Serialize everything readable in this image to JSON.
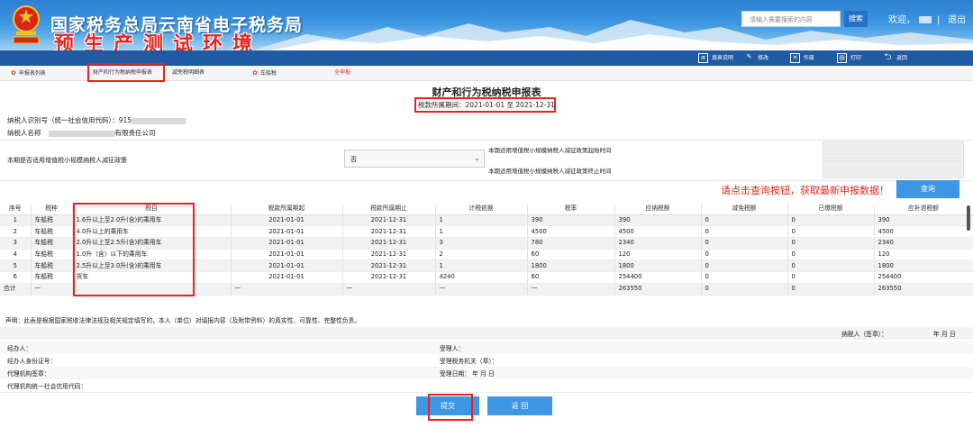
{
  "header": {
    "site_title": "国家税务总局云南省电子税务局",
    "env_title": "预生产测试环境",
    "search_placeholder": "请输入需要搜索的内容",
    "search_label": "搜索",
    "welcome": "欢迎，",
    "logout": "退出"
  },
  "toolbar": {
    "items": [
      "填表说明",
      "修改",
      "作废",
      "打印",
      "返回"
    ]
  },
  "tabs": {
    "items": [
      "申报表列表",
      "财产和行为税纳税申报表",
      "减免税明细表",
      "车船税",
      "全申报"
    ]
  },
  "form": {
    "title": "财产和行为税纳税申报表",
    "period_label": "税款所属期间：",
    "period_value": "2021-01-01 至 2021-12-31",
    "taxpayer_id_label": "纳税人识别号（统一社会信用代码）：",
    "taxpayer_id_prefix": "915",
    "taxpayer_name_label": "纳税人名称",
    "taxpayer_name_suffix": "有限责任公司"
  },
  "policy": {
    "question": "本期是否适用增值税小规模纳税人减征政策",
    "selected": "否",
    "start_label": "本期适用增值税小规模纳税人减征政策起始时间",
    "end_label": "本期适用增值税小规模纳税人减征政策终止时间"
  },
  "notice": {
    "prompt": "请点击查询按钮，获取最新申报数据！",
    "query_label": "查询"
  },
  "table": {
    "headers": [
      "序号",
      "税种",
      "税目",
      "税款所属期起",
      "税款所属期止",
      "计税依据",
      "税率",
      "应纳税额",
      "减免税额",
      "已缴税额",
      "应补退税额"
    ],
    "rows": [
      [
        "1",
        "车船税",
        "1.6升以上至2.0升(含)的乘用车",
        "2021-01-01",
        "2021-12-31",
        "1",
        "390",
        "390",
        "0",
        "0",
        "390"
      ],
      [
        "2",
        "车船税",
        "4.0升以上的乘用车",
        "2021-01-01",
        "2021-12-31",
        "1",
        "4500",
        "4500",
        "0",
        "0",
        "4500"
      ],
      [
        "3",
        "车船税",
        "2.0升以上至2.5升(含)的乘用车",
        "2021-01-01",
        "2021-12-31",
        "3",
        "780",
        "2340",
        "0",
        "0",
        "2340"
      ],
      [
        "4",
        "车船税",
        "1.0升（含）以下的乘用车",
        "2021-01-01",
        "2021-12-31",
        "2",
        "60",
        "120",
        "0",
        "0",
        "120"
      ],
      [
        "5",
        "车船税",
        "2.5升以上至3.0升(含)的乘用车",
        "2021-01-01",
        "2021-12-31",
        "1",
        "1800",
        "1800",
        "0",
        "0",
        "1800"
      ],
      [
        "6",
        "车船税",
        "货车",
        "2021-01-01",
        "2021-12-31",
        "4240",
        "60",
        "254400",
        "0",
        "0",
        "254400"
      ]
    ],
    "total": [
      "合计",
      "—",
      "",
      "—",
      "—",
      "—",
      "—",
      "263550",
      "0",
      "0",
      "263550"
    ]
  },
  "footer": {
    "statement": "声明：此表是根据国家税收法律法规及相关规定填写的，本人（单位）对填报内容（及附带资料）的真实性、可靠性、完整性负责。",
    "signer_label": "纳税人（签章）：",
    "date_label": "年 月 日",
    "operator": "经办人：",
    "operator_id": "经办人身份证号：",
    "agency_seal": "代理机构签章：",
    "agency_code": "代理机构统一社会信用代码：",
    "receiver": "受理人：",
    "receiving_office": "受理税务机关（章）：",
    "receive_date": "受理日期：  年 月 日",
    "submit_label": "提交",
    "back_label": "返 回"
  }
}
